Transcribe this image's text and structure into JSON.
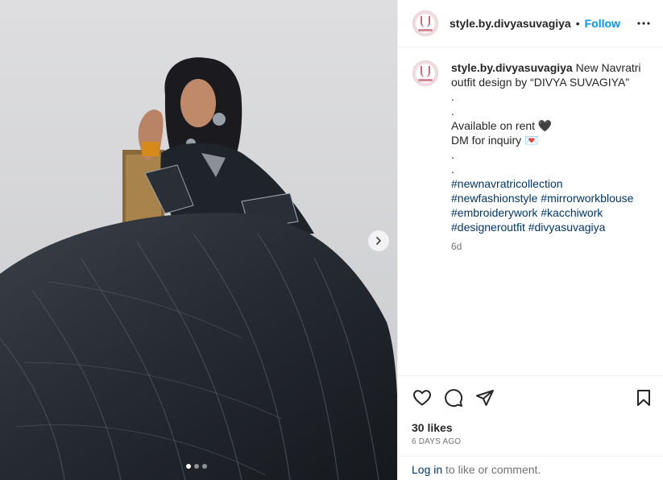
{
  "post": {
    "username": "style.by.divyasuvagiya",
    "separator": "•",
    "follow_label": "Follow",
    "more_icon": "more-horizontal-icon"
  },
  "caption": {
    "username": "style.by.divyasuvagiya",
    "lines": [
      "New Navratri",
      "outfit design by “DIVYA SUVAGIYA”",
      ".",
      ".",
      "Available on rent 🖤",
      "DM for inquiry 💌",
      ".",
      "."
    ],
    "hashtag_lines": [
      "#newnavratricollection",
      "#newfashionstyle #mirrorworkblouse",
      "#embroiderywork #kacchiwork",
      "#designeroutfit #divyasuvagiya"
    ],
    "time": "6d"
  },
  "actions": {
    "like_icon": "heart-icon",
    "comment_icon": "comment-icon",
    "share_icon": "share-icon",
    "save_icon": "bookmark-icon"
  },
  "likes": "30 likes",
  "ago": "6 DAYS AGO",
  "login": {
    "link": "Log in",
    "rest": " to like or comment."
  },
  "carousel": {
    "total": 3,
    "current": 1
  },
  "colors": {
    "accent": "#0095f6",
    "link": "#00376b",
    "muted": "#737373"
  }
}
